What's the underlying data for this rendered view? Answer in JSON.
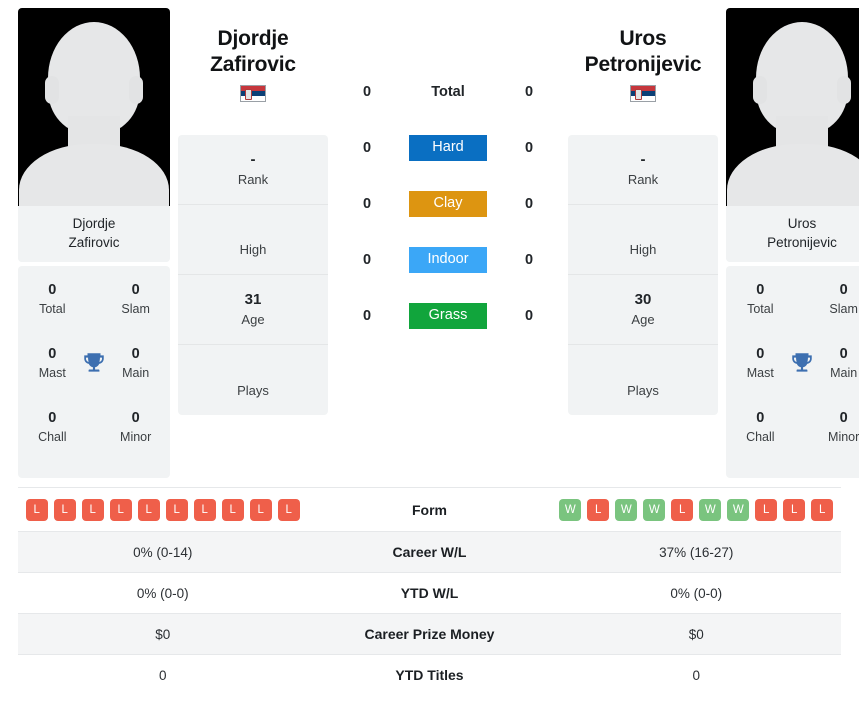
{
  "colors": {
    "win": "#7ac47f",
    "loss": "#ef5f4a",
    "hard": "#0a6fc2",
    "clay": "#dd9511",
    "indoor": "#3ba7f7",
    "grass": "#11a53c",
    "card_bg": "#f1f3f4",
    "trophy": "#3d6fb0"
  },
  "players": {
    "left": {
      "first_name": "Djordje",
      "last_name": "Zafirovic",
      "full_name": "Djordje Zafirovic",
      "photo_caption_line1": "Djordje",
      "photo_caption_line2": "Zafirovic",
      "flag": "serbia-flag",
      "info": [
        {
          "value": "-",
          "label": "Rank"
        },
        {
          "value": "",
          "label": "High"
        },
        {
          "value": "31",
          "label": "Age"
        },
        {
          "value": "",
          "label": "Plays"
        }
      ],
      "titles": [
        {
          "value": "0",
          "label": "Total"
        },
        {
          "value": "0",
          "label": "Slam"
        },
        {
          "value": "0",
          "label": "Mast"
        },
        {
          "value": "0",
          "label": "Main"
        },
        {
          "value": "0",
          "label": "Chall"
        },
        {
          "value": "0",
          "label": "Minor"
        }
      ],
      "surface_counts": {
        "total": "0",
        "hard": "0",
        "clay": "0",
        "indoor": "0",
        "grass": "0"
      },
      "form": [
        "L",
        "L",
        "L",
        "L",
        "L",
        "L",
        "L",
        "L",
        "L",
        "L"
      ],
      "career_wl": "0% (0-14)",
      "ytd_wl": "0% (0-0)",
      "career_prize_money": "$0",
      "ytd_titles": "0"
    },
    "right": {
      "first_name": "Uros",
      "last_name": "Petronijevic",
      "full_name": "Uros Petronijevic",
      "photo_caption_line1": "Uros",
      "photo_caption_line2": "Petronijevic",
      "flag": "serbia-flag",
      "info": [
        {
          "value": "-",
          "label": "Rank"
        },
        {
          "value": "",
          "label": "High"
        },
        {
          "value": "30",
          "label": "Age"
        },
        {
          "value": "",
          "label": "Plays"
        }
      ],
      "titles": [
        {
          "value": "0",
          "label": "Total"
        },
        {
          "value": "0",
          "label": "Slam"
        },
        {
          "value": "0",
          "label": "Mast"
        },
        {
          "value": "0",
          "label": "Main"
        },
        {
          "value": "0",
          "label": "Chall"
        },
        {
          "value": "0",
          "label": "Minor"
        }
      ],
      "surface_counts": {
        "total": "0",
        "hard": "0",
        "clay": "0",
        "indoor": "0",
        "grass": "0"
      },
      "form": [
        "W",
        "L",
        "W",
        "W",
        "L",
        "W",
        "W",
        "L",
        "L",
        "L"
      ],
      "career_wl": "37% (16-27)",
      "ytd_wl": "0% (0-0)",
      "career_prize_money": "$0",
      "ytd_titles": "0"
    }
  },
  "surfaces": [
    {
      "key": "total",
      "label": "Total",
      "badge": false
    },
    {
      "key": "hard",
      "label": "Hard",
      "badge": true
    },
    {
      "key": "clay",
      "label": "Clay",
      "badge": true
    },
    {
      "key": "indoor",
      "label": "Indoor",
      "badge": true
    },
    {
      "key": "grass",
      "label": "Grass",
      "badge": true
    }
  ],
  "table": {
    "rows": [
      {
        "label": "Form"
      },
      {
        "label": "Career W/L"
      },
      {
        "label": "YTD W/L"
      },
      {
        "label": "Career Prize Money"
      },
      {
        "label": "YTD Titles"
      }
    ]
  }
}
